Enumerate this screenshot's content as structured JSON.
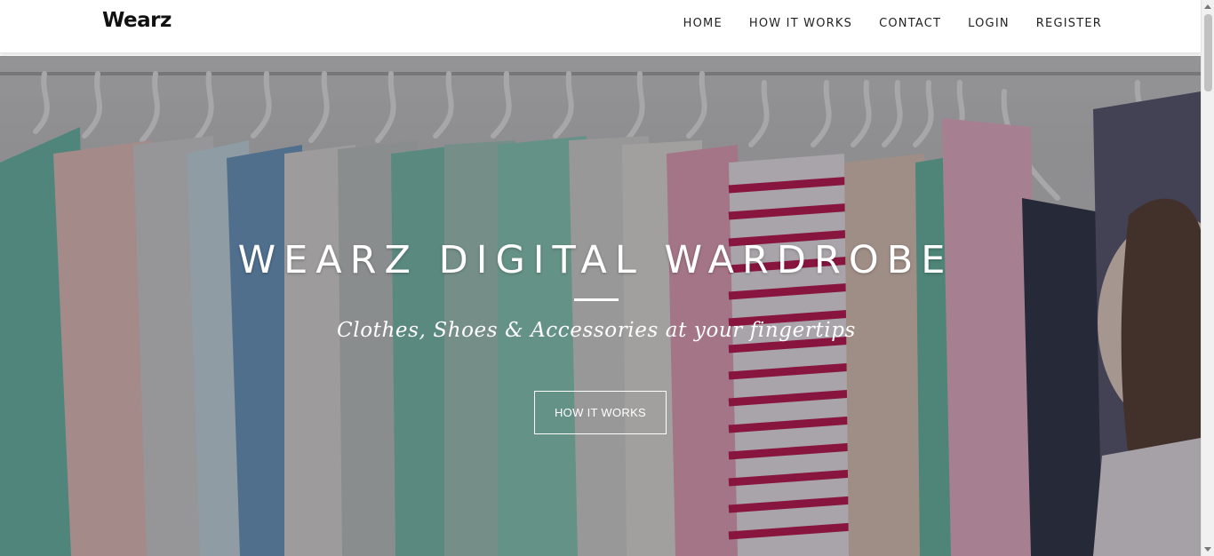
{
  "navbar": {
    "brand": "Wearz",
    "links": [
      "HOME",
      "HOW IT WORKS",
      "CONTACT",
      "LOGIN",
      "REGISTER"
    ]
  },
  "hero": {
    "title": "WEARZ DIGITAL WARDROBE",
    "subtitle": "Clothes, Shoes & Accessories at your fingertips",
    "button_label": "HOW IT WORKS",
    "background_icon": "clothing-rack-photo"
  },
  "colors": {
    "navbar_bg": "#ffffff",
    "text_dark": "#222222",
    "hero_text": "#ffffff"
  }
}
